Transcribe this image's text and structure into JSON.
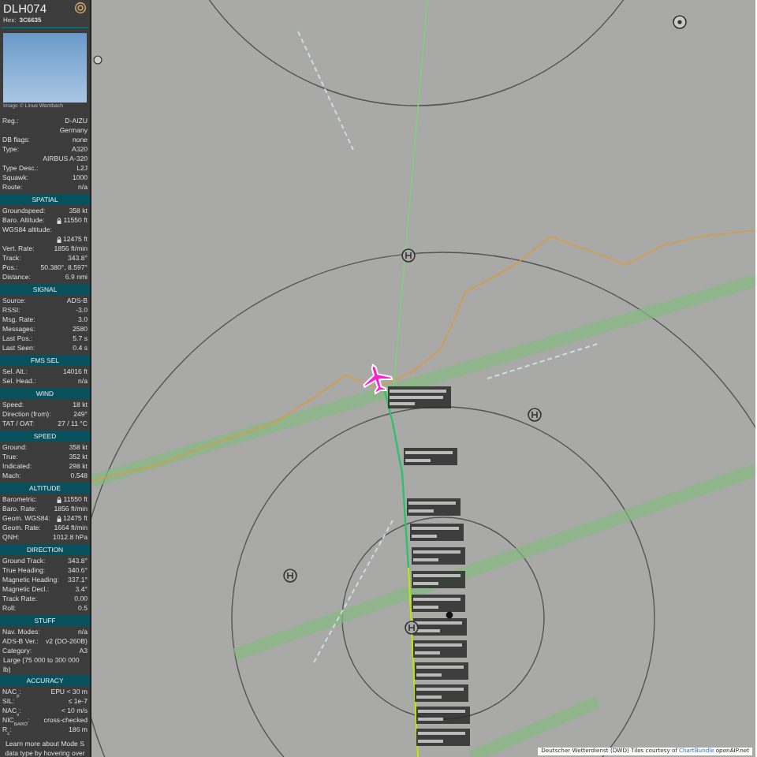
{
  "aircraft": {
    "callsign": "DLH074",
    "hex_label": "Hex:",
    "hex": "3C6635",
    "photo_credit": "Image © Linus Wambach"
  },
  "details": [
    {
      "label": "Reg.:",
      "value": "D-AIZU"
    },
    {
      "value": "Germany"
    },
    {
      "label": "DB flags:",
      "value": "none"
    },
    {
      "label": "Type:",
      "value": "A320"
    },
    {
      "value": "AIRBUS A-320"
    },
    {
      "label": "Type Desc.:",
      "value": "L2J"
    },
    {
      "label": "Squawk:",
      "value": "1000"
    },
    {
      "label": "Route:",
      "value": "n/a"
    }
  ],
  "sections": [
    {
      "title": "SPATIAL",
      "rows": [
        {
          "label": "Groundspeed:",
          "value": "358 kt"
        },
        {
          "label": "Baro. Altitude:",
          "value": "11550 ft",
          "locked": true
        },
        {
          "label": "WGS84 altitude:"
        },
        {
          "value": "12475 ft",
          "locked": true
        },
        {
          "label": "Vert. Rate:",
          "value": "1856 ft/min"
        },
        {
          "label": "Track:",
          "value": "343.8°"
        },
        {
          "label": "Pos.:",
          "value": "50.380°, 8.597°"
        },
        {
          "label": "Distance:",
          "value": "6.9 nmi"
        }
      ]
    },
    {
      "title": "SIGNAL",
      "rows": [
        {
          "label": "Source:",
          "value": "ADS-B"
        },
        {
          "label": "RSSI:",
          "value": "-3.0"
        },
        {
          "label": "Msg. Rate:",
          "value": "3.0"
        },
        {
          "label": "Messages:",
          "value": "2580"
        },
        {
          "label": "Last Pos.:",
          "value": "5.7 s"
        },
        {
          "label": "Last Seen:",
          "value": "0.4 s"
        }
      ]
    },
    {
      "title": "FMS SEL",
      "rows": [
        {
          "label": "Sel. Alt.:",
          "value": "14016 ft"
        },
        {
          "label": "Sel. Head.:",
          "value": "n/a"
        }
      ]
    },
    {
      "title": "WIND",
      "rows": [
        {
          "label": "Speed:",
          "value": "18 kt"
        },
        {
          "label": "Direction (from):",
          "value": "249°"
        },
        {
          "label": "TAT / OAT:",
          "value": "27 / 11 °C"
        }
      ]
    },
    {
      "title": "SPEED",
      "rows": [
        {
          "label": "Ground:",
          "value": "358 kt"
        },
        {
          "label": "True:",
          "value": "352 kt"
        },
        {
          "label": "Indicated:",
          "value": "298 kt"
        },
        {
          "label": "Mach:",
          "value": "0.548"
        }
      ]
    },
    {
      "title": "ALTITUDE",
      "rows": [
        {
          "label": "Barometric:",
          "value": "11550 ft",
          "locked": true
        },
        {
          "label": "Baro. Rate:",
          "value": "1856 ft/min"
        },
        {
          "label": "Geom. WGS84:",
          "value": "12475 ft",
          "locked": true
        },
        {
          "label": "Geom. Rate:",
          "value": "1664 ft/min"
        },
        {
          "label": "QNH:",
          "value": "1012.8 hPa"
        }
      ]
    },
    {
      "title": "DIRECTION",
      "rows": [
        {
          "label": "Ground Track:",
          "value": "343.8°"
        },
        {
          "label": "True Heading:",
          "value": "340.6°"
        },
        {
          "label": "Magnetic Heading:",
          "value": "337.1°"
        },
        {
          "label": "Magnetic Decl.:",
          "value": "3.4°"
        },
        {
          "label": "Track Rate:",
          "value": "0.00"
        },
        {
          "label": "Roll:",
          "value": "0.5"
        }
      ]
    },
    {
      "title": "STUFF",
      "rows": [
        {
          "label": "Nav. Modes:",
          "value": "n/a"
        },
        {
          "label": "ADS-B Ver.:",
          "value": "v2 (DO-260B)"
        },
        {
          "label": "Category:",
          "value": "A3"
        },
        {
          "note": "Large (75 000 to 300 000 lb)"
        }
      ]
    },
    {
      "title": "ACCURACY",
      "rows": [
        {
          "label": "NAC$_{p}$:",
          "value": "EPU < 30 m"
        },
        {
          "label": "SIL:",
          "value": "≤ 1e-7"
        },
        {
          "label": "NAC$_{v}$:",
          "value": "< 10 m/s"
        },
        {
          "label": "NIC$_{BARO}$:",
          "value": "cross-checked"
        },
        {
          "label": "R$_{c}$:",
          "value": "186 m"
        }
      ]
    }
  ],
  "footer": "Learn more about Mode S data type by hovering over",
  "attribution": {
    "text": "Deutscher Wetterdienst (DWD) Tiles courtesy of",
    "link": "ChartBundle",
    "source": "openAIP.net"
  }
}
